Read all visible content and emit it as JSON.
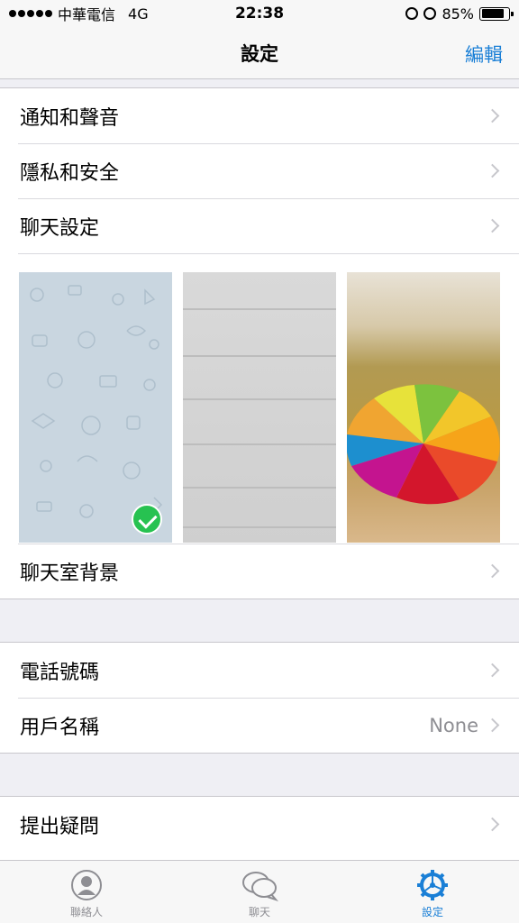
{
  "status_bar": {
    "carrier": "中華電信",
    "network": "4G",
    "time": "22:38",
    "battery_percent": "85%",
    "battery_level": 0.85
  },
  "nav": {
    "title": "設定",
    "edit_label": "編輯"
  },
  "section1": {
    "items": [
      {
        "label": "通知和聲音"
      },
      {
        "label": "隱私和安全"
      },
      {
        "label": "聊天設定"
      }
    ]
  },
  "wallpaper": {
    "label": "聊天室背景",
    "options": [
      "pattern-light-blue",
      "wood-planks-gray",
      "rainbow-umbrella"
    ],
    "selected_index": 0
  },
  "section2": {
    "items": [
      {
        "label": "電話號碼",
        "value": ""
      },
      {
        "label": "用戶名稱",
        "value": "None"
      }
    ]
  },
  "section3": {
    "items": [
      {
        "label": "提出疑問"
      }
    ]
  },
  "tabs": [
    {
      "label": "聯絡人",
      "icon": "person-icon",
      "active": false
    },
    {
      "label": "聊天",
      "icon": "chat-bubbles-icon",
      "active": false
    },
    {
      "label": "設定",
      "icon": "gear-icon",
      "active": true
    }
  ],
  "colors": {
    "accent": "#1a7fd6",
    "check": "#27c251",
    "background": "#efeff4"
  }
}
